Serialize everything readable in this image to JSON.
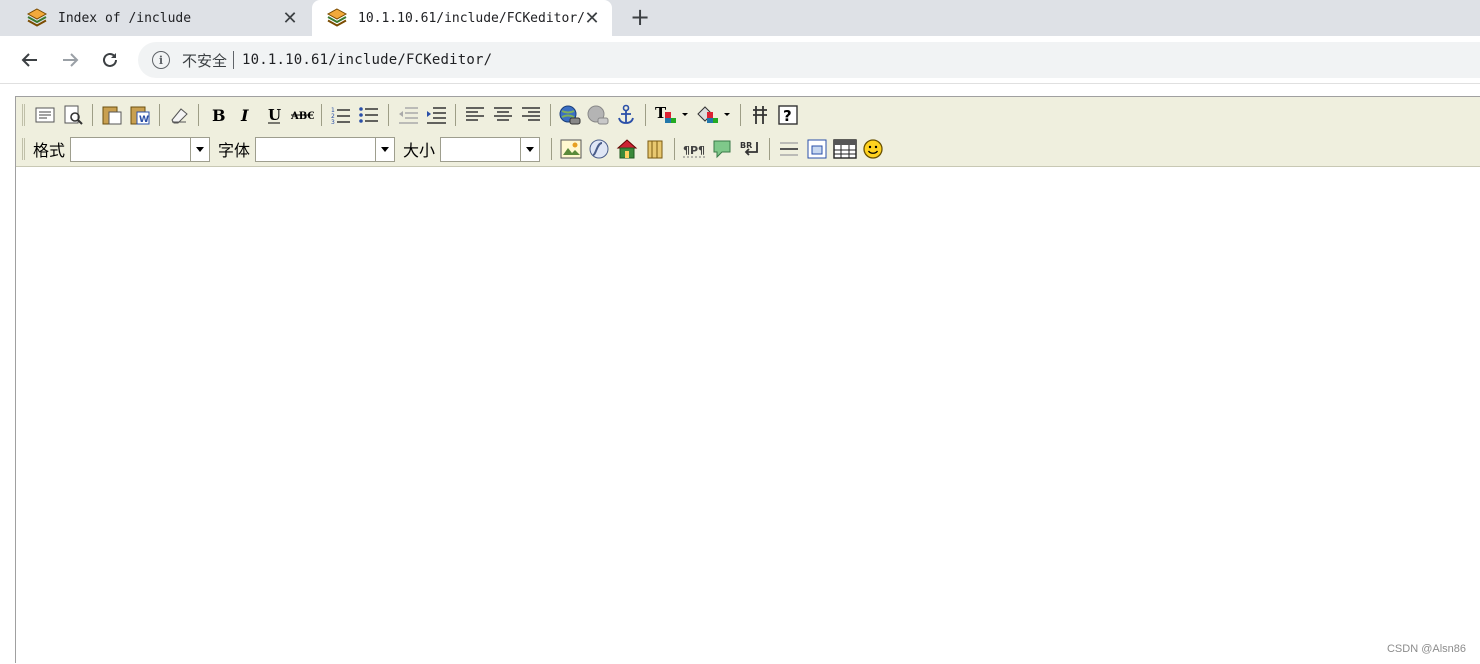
{
  "tabs": [
    {
      "title": "Index of /include",
      "favicon": "layered-stack-icon",
      "active": false
    },
    {
      "title": "10.1.10.61/include/FCKeditor/",
      "favicon": "layered-stack-icon",
      "active": true
    }
  ],
  "new_tab_icon": "+",
  "close_icon": "✕",
  "address_bar": {
    "security_label": "不安全",
    "url": "10.1.10.61/include/FCKeditor/"
  },
  "editor": {
    "toolbar_row1": [
      "source-icon",
      "preview-icon",
      "paste-icon",
      "paste-word-icon",
      "remove-format-icon",
      "bold-icon",
      "italic-icon",
      "underline-icon",
      "strikethrough-icon",
      "ordered-list-icon",
      "unordered-list-icon",
      "outdent-icon",
      "indent-icon",
      "align-left-icon",
      "align-center-icon",
      "align-right-icon",
      "link-icon",
      "unlink-icon",
      "anchor-icon",
      "text-color-icon",
      "bg-color-icon",
      "show-blocks-icon",
      "about-icon"
    ],
    "format_label": "格式",
    "font_label": "字体",
    "size_label": "大小",
    "format_value": "",
    "font_value": "",
    "size_value": ""
  },
  "watermark": "CSDN @Alsn86"
}
